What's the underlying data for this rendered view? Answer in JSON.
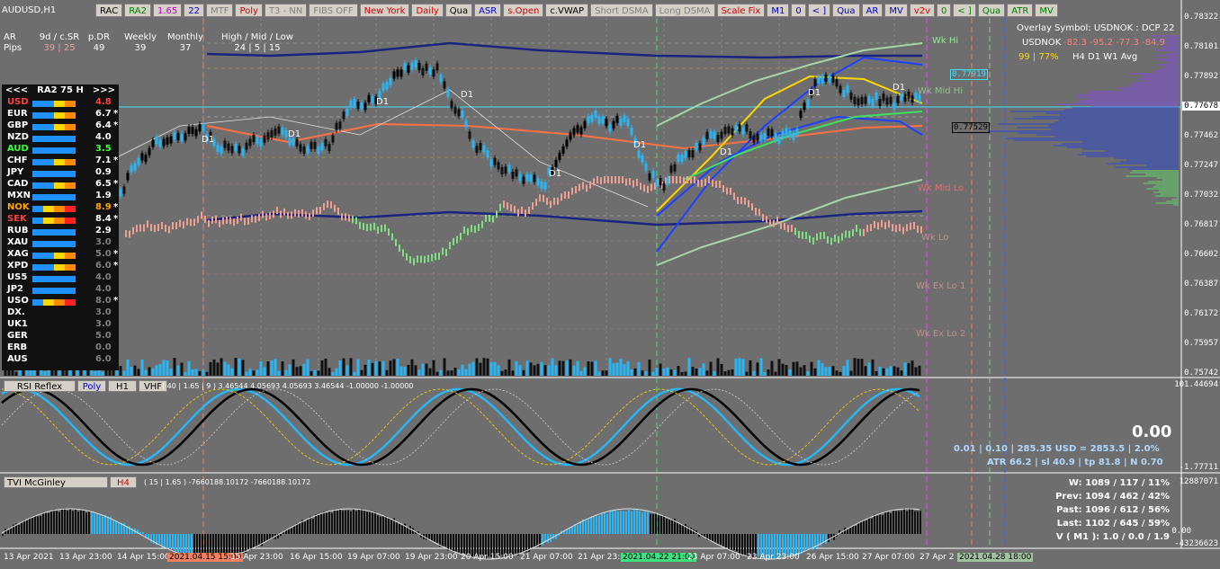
{
  "symbol": "AUDUSD,H1",
  "toolbar": [
    {
      "label": "RAC",
      "color": "#000"
    },
    {
      "label": "RA2",
      "color": "#008000"
    },
    {
      "label": "1.65",
      "color": "#c000c0"
    },
    {
      "label": "22",
      "color": "#0000c0"
    },
    {
      "label": "MTF",
      "color": "#808080"
    },
    {
      "label": "Poly",
      "color": "#d00000"
    },
    {
      "label": "T3 - NN",
      "color": "#808080"
    },
    {
      "label": "FIBS OFF",
      "color": "#808080"
    },
    {
      "label": "New York",
      "color": "#d00000"
    },
    {
      "label": "Daily",
      "color": "#d00000"
    },
    {
      "label": "Qua",
      "color": "#000"
    },
    {
      "label": "ASR",
      "color": "#0000c0"
    },
    {
      "label": "s.Open",
      "color": "#d00000"
    },
    {
      "label": "c.VWAP",
      "color": "#000"
    },
    {
      "label": "Short DSMA",
      "color": "#808080"
    },
    {
      "label": "Long DSMA",
      "color": "#808080"
    },
    {
      "label": "Scale Fix",
      "color": "#d00000"
    },
    {
      "label": "M1",
      "color": "#0000c0"
    },
    {
      "label": "0",
      "color": "#0000c0"
    },
    {
      "label": "< ]",
      "color": "#0000c0"
    },
    {
      "label": "Qua",
      "color": "#0000c0"
    },
    {
      "label": "AR",
      "color": "#0000c0"
    },
    {
      "label": "MV",
      "color": "#0000c0"
    },
    {
      "label": "v2v",
      "color": "#d00000"
    },
    {
      "label": "0",
      "color": "#008000"
    },
    {
      "label": "< ]",
      "color": "#008000"
    },
    {
      "label": "Qua",
      "color": "#008000"
    },
    {
      "label": "ATR",
      "color": "#008000"
    },
    {
      "label": "MV",
      "color": "#008000"
    }
  ],
  "stats_header": {
    "ar": "AR",
    "pips": "Pips",
    "cols": [
      {
        "h": "9d / c.SR",
        "v": "39 | 25"
      },
      {
        "h": "p.DR",
        "v": "49"
      },
      {
        "h": "Weekly",
        "v": "39"
      },
      {
        "h": "Monthly",
        "v": "37"
      },
      {
        "h": "High / Mid / Low",
        "v": "24  |  5  |  15"
      }
    ]
  },
  "panel": {
    "prev": "<<<",
    "title": "RA2  75  H",
    "next": ">>>",
    "rows": [
      {
        "name": "USD",
        "value": "4.8",
        "star": "",
        "name_color": "#ff4040",
        "value_color": "#ff4040",
        "bar": [
          "#1e90ff",
          "#1e90ff",
          "#ffd700",
          "#ff8c00"
        ]
      },
      {
        "name": "EUR",
        "value": "6.7",
        "star": "*",
        "name_color": "#ffffff",
        "value_color": "#ffffff",
        "bar": [
          "#1e90ff",
          "#1e90ff",
          "#ffd700",
          "#ff8c00"
        ]
      },
      {
        "name": "GBP",
        "value": "6.4",
        "star": "*",
        "name_color": "#ffffff",
        "value_color": "#ffffff",
        "bar": [
          "#1e90ff",
          "#1e90ff",
          "#ffd700",
          "#ff8c00"
        ]
      },
      {
        "name": "NZD",
        "value": "4.0",
        "star": "",
        "name_color": "#ffffff",
        "value_color": "#ffffff",
        "bar": [
          "#1e90ff",
          "#1e90ff",
          "#1e90ff",
          "#1e90ff"
        ]
      },
      {
        "name": "AUD",
        "value": "3.5",
        "star": "",
        "name_color": "#40ff40",
        "value_color": "#40ff40",
        "bar": [
          "#1e90ff",
          "#1e90ff",
          "#1e90ff",
          "#1e90ff"
        ]
      },
      {
        "name": "CHF",
        "value": "7.1",
        "star": "*",
        "name_color": "#ffffff",
        "value_color": "#ffffff",
        "bar": [
          "#1e90ff",
          "#1e90ff",
          "#ffd700",
          "#ff8c00"
        ]
      },
      {
        "name": "JPY",
        "value": "0.9",
        "star": "",
        "name_color": "#ffffff",
        "value_color": "#ffffff",
        "bar": [
          "#1e90ff",
          "#1e90ff",
          "#1e90ff",
          "#1e90ff"
        ]
      },
      {
        "name": "CAD",
        "value": "6.5",
        "star": "*",
        "name_color": "#ffffff",
        "value_color": "#ffffff",
        "bar": [
          "#1e90ff",
          "#1e90ff",
          "#ffd700",
          "#ff8c00"
        ]
      },
      {
        "name": "MXN",
        "value": "1.9",
        "star": "",
        "name_color": "#ffffff",
        "value_color": "#ffffff",
        "bar": [
          "#1e90ff",
          "#1e90ff",
          "#1e90ff",
          "#1e90ff"
        ]
      },
      {
        "name": "NOK",
        "value": "8.9",
        "star": "*",
        "name_color": "#ffa500",
        "value_color": "#ffa500",
        "bar": [
          "#1e90ff",
          "#ffd700",
          "#ff8c00",
          "#ff2020"
        ]
      },
      {
        "name": "SEK",
        "value": "8.4",
        "star": "*",
        "name_color": "#ff4040",
        "value_color": "#ffffff",
        "bar": [
          "#1e90ff",
          "#ffd700",
          "#ff8c00",
          "#ff2020"
        ]
      },
      {
        "name": "RUB",
        "value": "2.9",
        "star": "",
        "name_color": "#ffffff",
        "value_color": "#ffffff",
        "bar": [
          "#1e90ff",
          "#1e90ff",
          "#1e90ff",
          "#1e90ff"
        ]
      },
      {
        "name": "XAU",
        "value": "3.0",
        "star": "",
        "name_color": "#ffffff",
        "value_color": "#808080",
        "bar": [
          "#1e90ff",
          "#1e90ff",
          "#1e90ff",
          "#1e90ff"
        ]
      },
      {
        "name": "XAG",
        "value": "5.0",
        "star": "*",
        "name_color": "#ffffff",
        "value_color": "#808080",
        "bar": [
          "#1e90ff",
          "#1e90ff",
          "#ffd700",
          "#ff8c00"
        ]
      },
      {
        "name": "XPD",
        "value": "6.0",
        "star": "*",
        "name_color": "#ffffff",
        "value_color": "#808080",
        "bar": [
          "#1e90ff",
          "#1e90ff",
          "#ffd700",
          "#ff8c00"
        ]
      },
      {
        "name": "US5",
        "value": "4.0",
        "star": "",
        "name_color": "#ffffff",
        "value_color": "#808080",
        "bar": [
          "#1e90ff",
          "#1e90ff",
          "#1e90ff",
          "#1e90ff"
        ]
      },
      {
        "name": "JP2",
        "value": "4.0",
        "star": "",
        "name_color": "#ffffff",
        "value_color": "#808080",
        "bar": [
          "#1e90ff",
          "#1e90ff",
          "#1e90ff",
          "#1e90ff"
        ]
      },
      {
        "name": "USO",
        "value": "8.0",
        "star": "*",
        "name_color": "#ffffff",
        "value_color": "#808080",
        "bar": [
          "#1e90ff",
          "#ffd700",
          "#ff8c00",
          "#ff2020"
        ]
      },
      {
        "name": "DX.",
        "value": "3.0",
        "star": "",
        "name_color": "#ffffff",
        "value_color": "#808080",
        "bar": []
      },
      {
        "name": "UK1",
        "value": "3.0",
        "star": "",
        "name_color": "#ffffff",
        "value_color": "#808080",
        "bar": []
      },
      {
        "name": "GER",
        "value": "5.0",
        "star": "",
        "name_color": "#ffffff",
        "value_color": "#808080",
        "bar": []
      },
      {
        "name": "ERB",
        "value": "0.0",
        "star": "",
        "name_color": "#ffffff",
        "value_color": "#808080",
        "bar": []
      },
      {
        "name": "AUS",
        "value": "6.0",
        "star": "",
        "name_color": "#ffffff",
        "value_color": "#808080",
        "bar": []
      }
    ]
  },
  "overlay": {
    "title": "Overlay Symbol: USDNOK : DCP 22",
    "sym": "USDNOK",
    "vals": "-82.3  -95.2  -77.3  -84.9",
    "pct": "99 | 77%",
    "tfs": "H4     D1     W1    Avg"
  },
  "price_axis": [
    "0.78322",
    "0.78101",
    "0.77892",
    "0.77678",
    "0.77462",
    "0.77247",
    "0.77032",
    "0.76817",
    "0.76602",
    "0.76387",
    "0.76172",
    "0.75957",
    "0.75742"
  ],
  "price_tags": {
    "top": "0.77919",
    "current": "0.77678",
    "low": "0.77529"
  },
  "levels": [
    {
      "label": "Wk Hi",
      "color": "#90ee90"
    },
    {
      "label": "Wk Mid Hi",
      "color": "#90c090"
    },
    {
      "label": "Wk Mid Lo",
      "color": "#e07070"
    },
    {
      "label": "Wk Lo",
      "color": "#c09090"
    },
    {
      "label": "Wk Ex Lo 1",
      "color": "#c09090"
    },
    {
      "label": "Wk Ex Lo 2",
      "color": "#c09090"
    }
  ],
  "d1_labels": [
    "D1",
    "D1",
    "D1",
    "D1",
    "D1",
    "D1",
    "D1",
    "D1",
    "D1"
  ],
  "rsi": {
    "buttons": [
      {
        "label": "RSI Reflex",
        "color": "#000"
      },
      {
        "label": "Poly",
        "color": "#0000c0"
      },
      {
        "label": "H1",
        "color": "#000"
      },
      {
        "label": "VHF",
        "color": "#000"
      }
    ],
    "params": "( 40 | 1.65 | 9 ) 3.46544 4.05693 4.05693 3.46544 -1.00000 -1.00000",
    "big": "0.00",
    "line1": "0.01  |  0.10  |  285.35 USD = 2853.5  |  2.0%",
    "line2": "ATR 66.2  |  sl 40.9  |  tp 81.8  |  N 0.70",
    "axis_top": "101.44694",
    "axis_bot": "-1.77711"
  },
  "tvi": {
    "buttons": [
      {
        "label": "TVI McGinley",
        "color": "#000"
      },
      {
        "label": "H4",
        "color": "#d00000"
      }
    ],
    "params": "( 15 | 1.65 ) -7660188.10172 -7660188.10172",
    "axis_top": "12887071",
    "axis_mid": "0.00",
    "axis_bot": "-43236623",
    "stats": [
      "W: 1089 / 117 / 11%",
      "Prev: 1094 / 462 / 42%",
      "Past: 1096 / 612 / 56%",
      "Last: 1102 / 645 / 59%",
      "V ( M1 ): 1.0 / 0.0 / 1.9"
    ]
  },
  "time_axis": [
    {
      "label": "13 Apr 2021",
      "hl": ""
    },
    {
      "label": "13 Apr 23:00",
      "hl": ""
    },
    {
      "label": "14 Apr 15:00",
      "hl": ""
    },
    {
      "label": "2021.04.15 15:00",
      "hl": "#f08060"
    },
    {
      "label": "15 Apr 23:00",
      "hl": ""
    },
    {
      "label": "16 Apr 15:00",
      "hl": ""
    },
    {
      "label": "19 Apr 07:00",
      "hl": ""
    },
    {
      "label": "19 Apr 23:00",
      "hl": ""
    },
    {
      "label": "20 Apr 15:00",
      "hl": ""
    },
    {
      "label": "21 Apr 07:00",
      "hl": ""
    },
    {
      "label": "21 Apr 23:00",
      "hl": ""
    },
    {
      "label": "2021.04.22 21:00",
      "hl": "#40e080"
    },
    {
      "label": "23 Apr 07:00",
      "hl": ""
    },
    {
      "label": "23 Apr 23:00",
      "hl": ""
    },
    {
      "label": "26 Apr 15:00",
      "hl": ""
    },
    {
      "label": "27 Apr 07:00",
      "hl": ""
    },
    {
      "label": "27 Apr 2",
      "hl": ""
    },
    {
      "label": "2021.04.28 18:00",
      "hl": "#a0c0a0"
    }
  ]
}
